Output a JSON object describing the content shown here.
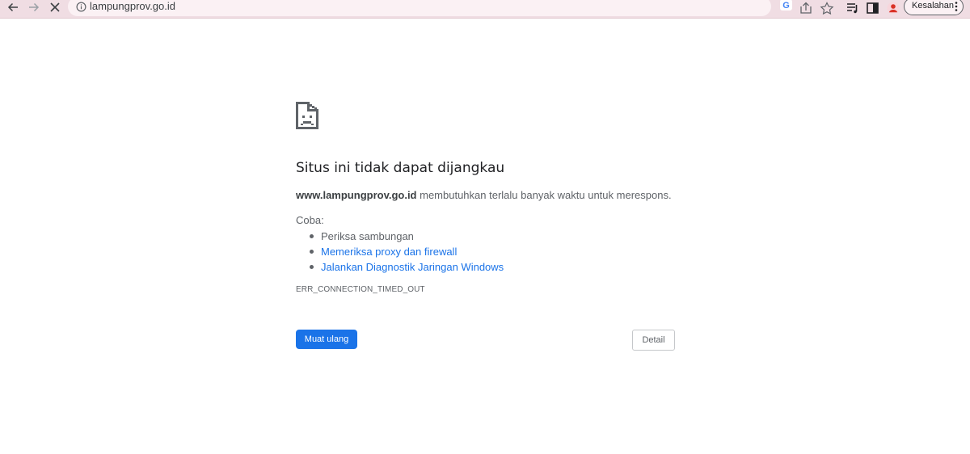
{
  "browser": {
    "url": "lampungprov.go.id",
    "profile_label": "Kesalahan",
    "icons": {
      "back": "back-arrow-icon",
      "forward": "forward-arrow-icon",
      "stop": "close-icon",
      "site_info": "info-icon",
      "google": "google-icon",
      "share": "share-icon",
      "bookmark": "star-icon",
      "reading_list": "reading-list-icon",
      "side_panel": "side-panel-icon",
      "profile": "profile-avatar-icon",
      "menu": "kebab-menu-icon"
    },
    "colors": {
      "toolbar_bg": "#f0dde3",
      "profile_avatar": "#d93025"
    }
  },
  "error_page": {
    "icon": "sad-document-icon",
    "title": "Situs ini tidak dapat dijangkau",
    "host": "www.lampungprov.go.id",
    "description": " membutuhkan terlalu banyak waktu untuk merespons.",
    "try_label": "Coba:",
    "suggestions": [
      {
        "text": "Periksa sambungan",
        "link": false
      },
      {
        "text": "Memeriksa proxy dan firewall",
        "link": true
      },
      {
        "text": "Jalankan Diagnostik Jaringan Windows",
        "link": true
      }
    ],
    "error_code": "ERR_CONNECTION_TIMED_OUT",
    "reload_label": "Muat ulang",
    "details_label": "Detail",
    "colors": {
      "link": "#1a73e8",
      "primary_button": "#1a73e8"
    }
  }
}
